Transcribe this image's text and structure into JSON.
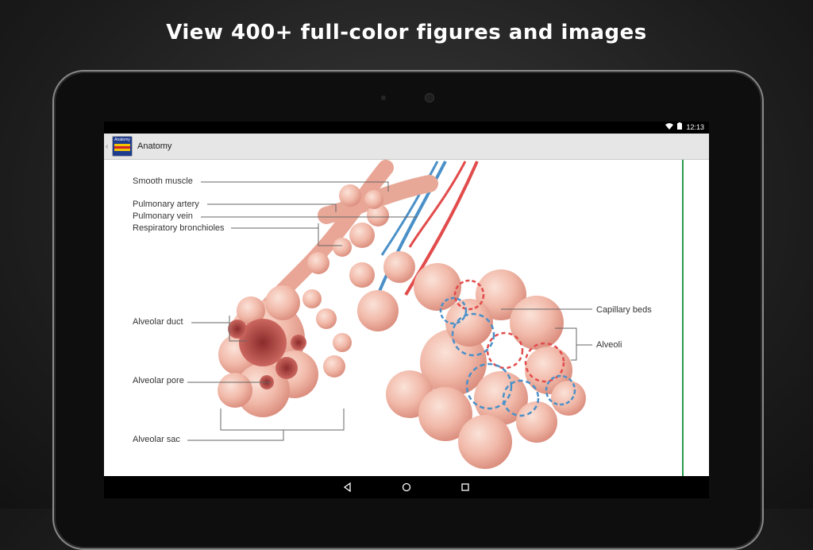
{
  "promo": {
    "headline": "View 400+ full-color figures and images"
  },
  "status_bar": {
    "time": "12:13",
    "icons": [
      "wifi-icon",
      "battery-icon"
    ]
  },
  "app_bar": {
    "title": "Anatomy",
    "icon": {
      "line1": "Anatomy",
      "line2": "Incredibly Easy!"
    }
  },
  "figure": {
    "labels": {
      "smooth_muscle": "Smooth muscle",
      "pulmonary_artery": "Pulmonary artery",
      "pulmonary_vein": "Pulmonary vein",
      "respiratory_bronchioles": "Respiratory bronchioles",
      "alveolar_duct": "Alveolar duct",
      "alveolar_pore": "Alveolar pore",
      "alveolar_sac": "Alveolar sac",
      "capillary_beds": "Capillary beds",
      "alveoli": "Alveoli"
    },
    "colors": {
      "alveolus": "#f0b8a8",
      "artery": "#e24b4b",
      "vein": "#4a90c8",
      "scroll_indicator": "#2e9a4e"
    }
  },
  "nav_bar": {
    "buttons": [
      "back-icon",
      "home-icon",
      "recents-icon"
    ]
  }
}
